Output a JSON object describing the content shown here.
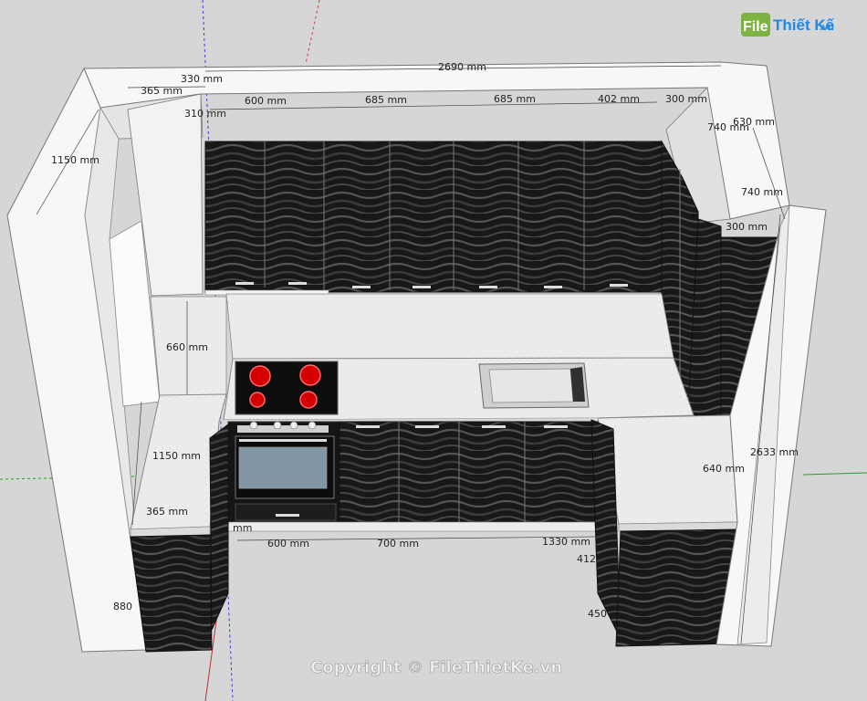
{
  "watermark": {
    "logo_badge": "File",
    "logo_text": "Thiết Kế",
    "logo_domain": ".vn",
    "copyright": "Copyright © FileThietKe.vn"
  },
  "colors": {
    "background": "#d6d6d6",
    "panel_white": "#f7f7f7",
    "cabinet_dark": "#1b1b1b",
    "countertop": "#ececec",
    "hob_burner": "#d40000",
    "logo_green": "#7cb342",
    "logo_blue": "#1e88e5"
  },
  "dimensions": [
    "2690 mm",
    "330 mm",
    "365 mm",
    "310 mm",
    "600 mm",
    "685 mm",
    "685 mm",
    "402 mm",
    "300 mm",
    "740 mm",
    "630 mm",
    "740 mm",
    "300 mm",
    "1150 mm",
    "660 mm",
    "1150 mm",
    "365 mm",
    "2633 mm",
    "640 mm",
    "600 mm",
    "700 mm",
    "1330 mm",
    "412",
    "880",
    "450",
    "mm"
  ]
}
